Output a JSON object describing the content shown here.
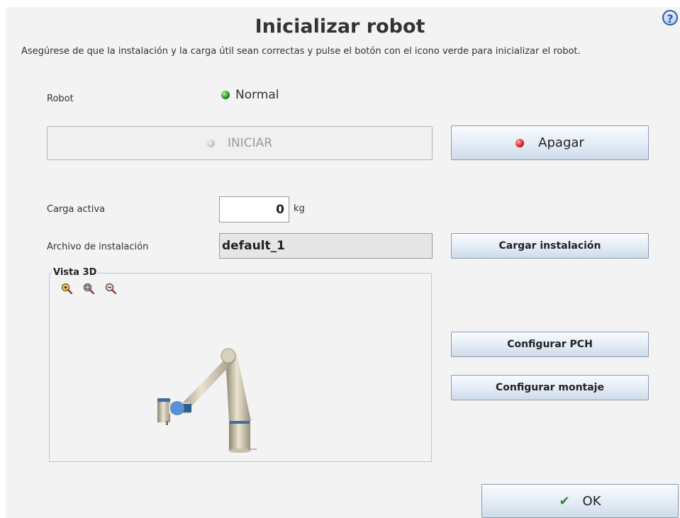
{
  "header": {
    "title": "Inicializar robot",
    "help_label": "?",
    "description": "Asegúrese de que la instalación y la carga útil sean correctas y pulse el botón con el icono verde para inicializar el robot."
  },
  "robot": {
    "label": "Robot",
    "status": "Normal",
    "status_color": "#1d8a1d"
  },
  "buttons": {
    "start": "INICIAR",
    "power_off": "Apagar",
    "load_installation": "Cargar instalación",
    "configure_tcp": "Configurar PCH",
    "configure_mounting": "Configurar montaje",
    "ok": "OK"
  },
  "payload": {
    "label": "Carga activa",
    "value": "0",
    "unit": "kg"
  },
  "installation": {
    "label": "Archivo de instalación",
    "file": "default_1"
  },
  "view3d": {
    "legend": "Vista 3D",
    "zoom_icons": [
      "zoom-in-icon",
      "zoom-fit-icon",
      "zoom-out-icon"
    ]
  },
  "colors": {
    "accent_green": "#1d8a1d",
    "accent_red": "#d81a1a",
    "button_gradient_top": "#f9fbfe",
    "button_gradient_bottom": "#cfdbe9"
  }
}
